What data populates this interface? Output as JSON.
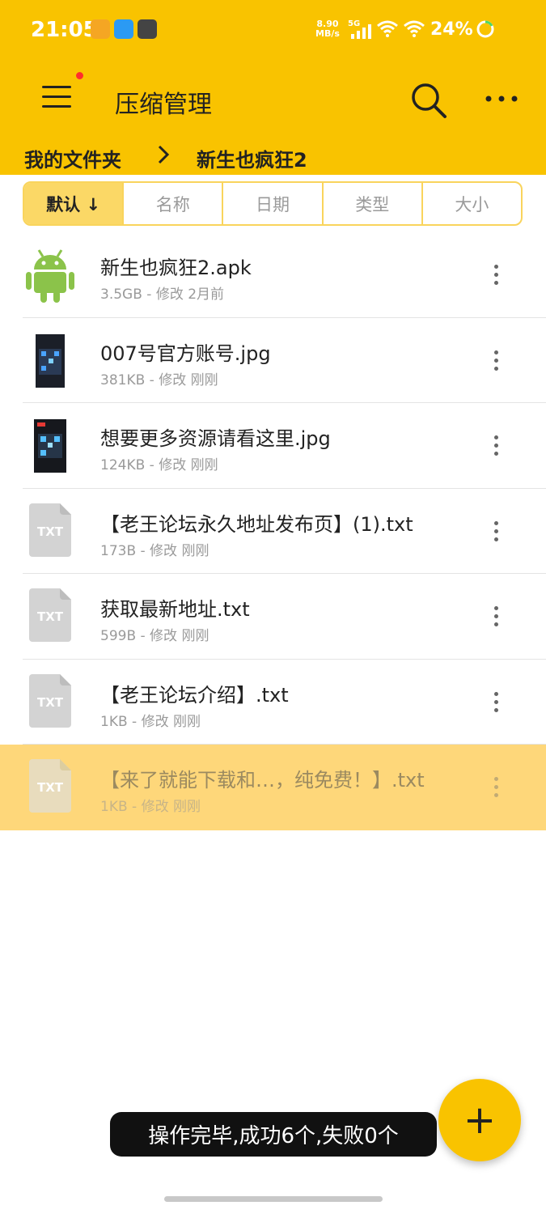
{
  "status": {
    "time": "21:05",
    "net_speed_value": "8.90",
    "net_speed_unit": "MB/s",
    "network": "5G",
    "battery": "24%"
  },
  "header": {
    "title": "压缩管理"
  },
  "breadcrumb": {
    "root": "我的文件夹",
    "current": "新生也疯狂2"
  },
  "sort": {
    "tabs": [
      "默认 ↓",
      "名称",
      "日期",
      "类型",
      "大小"
    ]
  },
  "files": [
    {
      "name": "新生也疯狂2.apk",
      "meta": "3.5GB - 修改 2月前",
      "type": "apk"
    },
    {
      "name": "007号官方账号.jpg",
      "meta": "381KB - 修改 刚刚",
      "type": "jpg"
    },
    {
      "name": "想要更多资源请看这里.jpg",
      "meta": "124KB - 修改 刚刚",
      "type": "jpg"
    },
    {
      "name": "【老王论坛永久地址发布页】(1).txt",
      "meta": "173B - 修改 刚刚",
      "type": "txt"
    },
    {
      "name": "获取最新地址.txt",
      "meta": "599B - 修改 刚刚",
      "type": "txt"
    },
    {
      "name": "【老王论坛介绍】.txt",
      "meta": "1KB - 修改 刚刚",
      "type": "txt"
    },
    {
      "name": "【来了就能下载和…，纯免费！】.txt",
      "meta": "1KB - 修改 刚刚",
      "type": "txt"
    }
  ],
  "txt_icon_label": "TXT",
  "toast": "操作完毕,成功6个,失败0个",
  "fab_label": "+",
  "colors": {
    "accent": "#F9C300",
    "selected_row": "#FED77A"
  }
}
